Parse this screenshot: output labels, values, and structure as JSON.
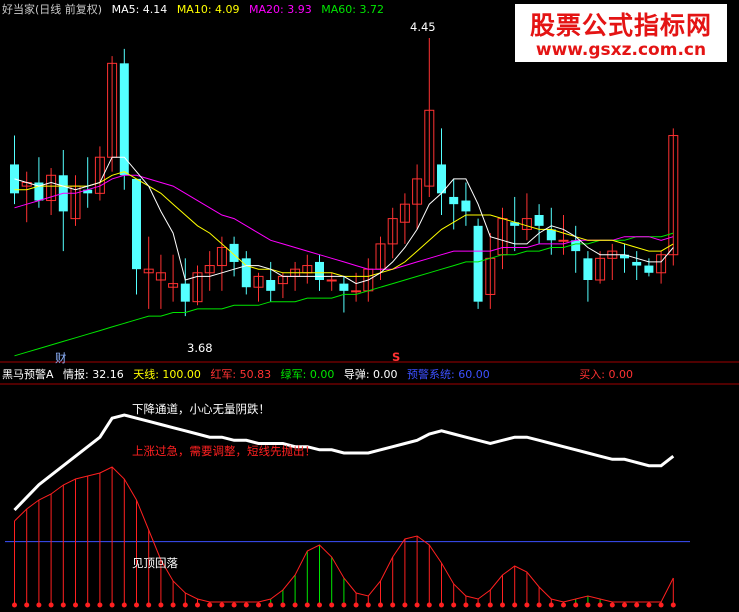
{
  "main_header": {
    "title": "好当家(日线 前复权)",
    "ma5": "MA5: 4.14",
    "ma10": "MA10: 4.09",
    "ma20": "MA20: 3.93",
    "ma60": "MA60: 3.72"
  },
  "banner": {
    "title": "股票公式指标网",
    "url": "www.gsxz.com.cn"
  },
  "annotations": {
    "high": "4.45",
    "low": "3.68",
    "cai_marker": "财",
    "s_marker": "S"
  },
  "indicator_header": {
    "name": "黑马预警A",
    "intel": "情报: 32.16",
    "sky": "天线: 100.00",
    "red": "红军: 50.83",
    "green": "绿军: 0.00",
    "missile": "导弹: 0.00",
    "warning": "预警系统: 60.00",
    "buy": "买入: 0.00"
  },
  "indicator_notes": {
    "down_channel": "下降通道，小心无量阴跌！",
    "overheat": "上涨过急，需要调整，短线先抛出！",
    "top_fall": "见顶回落"
  },
  "colors": {
    "up": "#ff3232",
    "down": "#54ffff",
    "ma5": "#ffffff",
    "ma10": "#ffff00",
    "ma20": "#ff00ff",
    "ma60": "#00e600",
    "panel_border": "#a00000"
  },
  "chart_data": {
    "type": "candlestick",
    "ohlc": [
      [
        4.1,
        4.18,
        3.99,
        4.02
      ],
      [
        4.04,
        4.08,
        3.94,
        4.05
      ],
      [
        4.05,
        4.12,
        3.98,
        4.0
      ],
      [
        4.0,
        4.09,
        3.96,
        4.07
      ],
      [
        4.07,
        4.14,
        3.86,
        3.97
      ],
      [
        3.95,
        4.07,
        3.93,
        4.04
      ],
      [
        4.03,
        4.12,
        3.98,
        4.02
      ],
      [
        4.02,
        4.15,
        4.0,
        4.12
      ],
      [
        4.12,
        4.4,
        4.08,
        4.38
      ],
      [
        4.38,
        4.42,
        4.03,
        4.07
      ],
      [
        4.06,
        4.06,
        3.74,
        3.81
      ],
      [
        3.8,
        3.9,
        3.7,
        3.81
      ],
      [
        3.78,
        3.85,
        3.7,
        3.8
      ],
      [
        3.76,
        3.85,
        3.72,
        3.77
      ],
      [
        3.77,
        3.84,
        3.68,
        3.72
      ],
      [
        3.72,
        3.82,
        3.71,
        3.8
      ],
      [
        3.8,
        3.86,
        3.75,
        3.82
      ],
      [
        3.82,
        3.9,
        3.75,
        3.87
      ],
      [
        3.88,
        3.9,
        3.79,
        3.83
      ],
      [
        3.84,
        3.86,
        3.74,
        3.76
      ],
      [
        3.76,
        3.8,
        3.72,
        3.79
      ],
      [
        3.78,
        3.83,
        3.72,
        3.75
      ],
      [
        3.77,
        3.8,
        3.73,
        3.79
      ],
      [
        3.79,
        3.83,
        3.75,
        3.81
      ],
      [
        3.8,
        3.85,
        3.77,
        3.82
      ],
      [
        3.83,
        3.85,
        3.75,
        3.78
      ],
      [
        3.78,
        3.8,
        3.75,
        3.78
      ],
      [
        3.77,
        3.79,
        3.69,
        3.75
      ],
      [
        3.75,
        3.8,
        3.72,
        3.75
      ],
      [
        3.75,
        3.84,
        3.72,
        3.81
      ],
      [
        3.81,
        3.9,
        3.78,
        3.88
      ],
      [
        3.88,
        3.98,
        3.84,
        3.95
      ],
      [
        3.94,
        4.02,
        3.88,
        3.99
      ],
      [
        3.99,
        4.1,
        3.92,
        4.06
      ],
      [
        4.04,
        4.45,
        4.01,
        4.25
      ],
      [
        4.1,
        4.2,
        3.96,
        4.02
      ],
      [
        4.01,
        4.06,
        3.92,
        3.99
      ],
      [
        4.0,
        4.05,
        3.93,
        3.97
      ],
      [
        3.93,
        3.95,
        3.7,
        3.72
      ],
      [
        3.74,
        3.91,
        3.7,
        3.84
      ],
      [
        3.85,
        3.98,
        3.81,
        3.95
      ],
      [
        3.94,
        4.01,
        3.86,
        3.93
      ],
      [
        3.92,
        4.02,
        3.89,
        3.95
      ],
      [
        3.96,
        3.99,
        3.88,
        3.93
      ],
      [
        3.92,
        3.98,
        3.85,
        3.89
      ],
      [
        3.89,
        3.96,
        3.85,
        3.89
      ],
      [
        3.89,
        3.93,
        3.8,
        3.86
      ],
      [
        3.84,
        3.86,
        3.72,
        3.78
      ],
      [
        3.78,
        3.86,
        3.77,
        3.84
      ],
      [
        3.84,
        3.88,
        3.78,
        3.86
      ],
      [
        3.85,
        3.88,
        3.8,
        3.84
      ],
      [
        3.83,
        3.86,
        3.78,
        3.82
      ],
      [
        3.82,
        3.84,
        3.79,
        3.8
      ],
      [
        3.8,
        3.86,
        3.77,
        3.85
      ],
      [
        3.85,
        4.2,
        3.82,
        4.18
      ]
    ],
    "ma5": [
      4.06,
      4.05,
      4.04,
      4.05,
      4.04,
      4.03,
      4.04,
      4.05,
      4.12,
      4.12,
      4.08,
      4.04,
      3.97,
      3.91,
      3.78,
      3.79,
      3.79,
      3.8,
      3.81,
      3.82,
      3.82,
      3.81,
      3.79,
      3.79,
      3.79,
      3.79,
      3.79,
      3.79,
      3.77,
      3.78,
      3.8,
      3.83,
      3.87,
      3.92,
      3.99,
      4.02,
      4.06,
      4.06,
      3.99,
      3.9,
      3.89,
      3.88,
      3.88,
      3.91,
      3.93,
      3.92,
      3.9,
      3.87,
      3.85,
      3.85,
      3.85,
      3.84,
      3.83,
      3.83,
      3.87
    ],
    "ma10": [
      4.03,
      4.03,
      4.04,
      4.04,
      4.04,
      4.04,
      4.04,
      4.05,
      4.07,
      4.08,
      4.06,
      4.04,
      4.02,
      3.99,
      3.96,
      3.93,
      3.91,
      3.88,
      3.85,
      3.82,
      3.81,
      3.81,
      3.8,
      3.8,
      3.8,
      3.8,
      3.8,
      3.79,
      3.79,
      3.79,
      3.8,
      3.81,
      3.83,
      3.86,
      3.89,
      3.92,
      3.94,
      3.96,
      3.96,
      3.96,
      3.95,
      3.94,
      3.93,
      3.92,
      3.92,
      3.91,
      3.9,
      3.89,
      3.89,
      3.89,
      3.88,
      3.87,
      3.86,
      3.86,
      3.88
    ],
    "ma20": [
      3.98,
      3.99,
      4.0,
      4.01,
      4.02,
      4.02,
      4.03,
      4.04,
      4.06,
      4.07,
      4.07,
      4.06,
      4.05,
      4.04,
      4.02,
      4.0,
      3.98,
      3.96,
      3.95,
      3.93,
      3.91,
      3.89,
      3.88,
      3.87,
      3.86,
      3.85,
      3.84,
      3.83,
      3.82,
      3.81,
      3.81,
      3.81,
      3.82,
      3.83,
      3.84,
      3.85,
      3.86,
      3.86,
      3.86,
      3.86,
      3.87,
      3.87,
      3.87,
      3.88,
      3.88,
      3.88,
      3.89,
      3.89,
      3.89,
      3.89,
      3.9,
      3.9,
      3.9,
      3.89,
      3.9
    ],
    "ma60": [
      3.57,
      3.58,
      3.59,
      3.6,
      3.61,
      3.62,
      3.63,
      3.64,
      3.65,
      3.66,
      3.67,
      3.68,
      3.68,
      3.69,
      3.69,
      3.7,
      3.7,
      3.7,
      3.71,
      3.71,
      3.71,
      3.72,
      3.72,
      3.72,
      3.73,
      3.73,
      3.73,
      3.74,
      3.74,
      3.75,
      3.76,
      3.77,
      3.78,
      3.79,
      3.8,
      3.81,
      3.82,
      3.83,
      3.83,
      3.84,
      3.85,
      3.85,
      3.86,
      3.86,
      3.87,
      3.87,
      3.88,
      3.88,
      3.89,
      3.89,
      3.89,
      3.9,
      3.9,
      3.9,
      3.91
    ],
    "indicator_line": [
      70,
      74,
      78,
      81,
      84,
      87,
      90,
      93,
      99,
      100,
      99,
      98,
      97,
      96,
      95,
      94,
      93,
      93,
      92,
      92,
      91,
      91,
      91,
      90,
      90,
      89,
      89,
      88,
      88,
      88,
      89,
      90,
      91,
      92,
      94,
      95,
      94,
      93,
      92,
      91,
      92,
      93,
      93,
      92,
      91,
      90,
      89,
      88,
      87,
      86,
      86,
      85,
      84,
      84,
      87
    ],
    "warning_level": 60,
    "bars": [
      {
        "v": 28,
        "c": "red"
      },
      {
        "v": 32,
        "c": "red"
      },
      {
        "v": 35,
        "c": "red"
      },
      {
        "v": 37,
        "c": "red"
      },
      {
        "v": 40,
        "c": "red"
      },
      {
        "v": 42,
        "c": "red"
      },
      {
        "v": 43,
        "c": "red"
      },
      {
        "v": 44,
        "c": "red"
      },
      {
        "v": 46,
        "c": "red"
      },
      {
        "v": 42,
        "c": "red"
      },
      {
        "v": 35,
        "c": "red"
      },
      {
        "v": 25,
        "c": "red"
      },
      {
        "v": 15,
        "c": "red"
      },
      {
        "v": 8,
        "c": "red"
      },
      {
        "v": 4,
        "c": "red"
      },
      {
        "v": 2,
        "c": "red"
      },
      {
        "v": 1,
        "c": "red"
      },
      {
        "v": 1,
        "c": "red"
      },
      {
        "v": 1,
        "c": "red"
      },
      {
        "v": 1,
        "c": "red"
      },
      {
        "v": 1,
        "c": "red"
      },
      {
        "v": 2,
        "c": "green"
      },
      {
        "v": 5,
        "c": "green"
      },
      {
        "v": 10,
        "c": "green"
      },
      {
        "v": 18,
        "c": "green"
      },
      {
        "v": 20,
        "c": "green"
      },
      {
        "v": 16,
        "c": "green"
      },
      {
        "v": 9,
        "c": "green"
      },
      {
        "v": 4,
        "c": "red"
      },
      {
        "v": 3,
        "c": "red"
      },
      {
        "v": 8,
        "c": "red"
      },
      {
        "v": 16,
        "c": "red"
      },
      {
        "v": 22,
        "c": "red"
      },
      {
        "v": 23,
        "c": "red"
      },
      {
        "v": 20,
        "c": "red"
      },
      {
        "v": 14,
        "c": "red"
      },
      {
        "v": 7,
        "c": "red"
      },
      {
        "v": 3,
        "c": "red"
      },
      {
        "v": 2,
        "c": "red"
      },
      {
        "v": 5,
        "c": "red"
      },
      {
        "v": 10,
        "c": "red"
      },
      {
        "v": 13,
        "c": "red"
      },
      {
        "v": 11,
        "c": "red"
      },
      {
        "v": 6,
        "c": "red"
      },
      {
        "v": 2,
        "c": "red"
      },
      {
        "v": 1,
        "c": "red"
      },
      {
        "v": 2,
        "c": "green"
      },
      {
        "v": 3,
        "c": "green"
      },
      {
        "v": 2,
        "c": "green"
      },
      {
        "v": 1,
        "c": "green"
      },
      {
        "v": 1,
        "c": "red"
      },
      {
        "v": 1,
        "c": "red"
      },
      {
        "v": 1,
        "c": "red"
      },
      {
        "v": 1,
        "c": "red"
      },
      {
        "v": 9,
        "c": "red"
      }
    ]
  }
}
